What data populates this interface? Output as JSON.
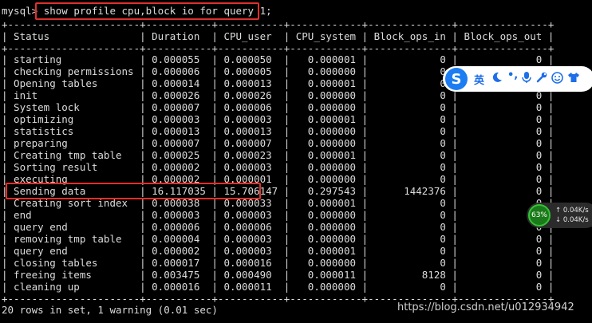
{
  "terminal": {
    "prompt": "mysql> ",
    "command": "show profile cpu,block io for query 1;",
    "separator": "+----------------------+-----------+-----------+------------+--------------+---------------+",
    "header": "| Status               | Duration  | CPU_user  | CPU_system | Block_ops_in | Block_ops_out |",
    "rows": [
      "| starting             | 0.000055  | 0.000050  |   0.000001 |            0 |             0 |",
      "| checking permissions | 0.000006  | 0.000005  |   0.000000 |            0 |             0 |",
      "| Opening tables       | 0.000014  | 0.000013  |   0.000001 |            0 |             0 |",
      "| init                 | 0.000026  | 0.000026  |   0.000000 |            0 |             0 |",
      "| System lock          | 0.000007  | 0.000006  |   0.000000 |            0 |             0 |",
      "| optimizing           | 0.000003  | 0.000003  |   0.000001 |            0 |             0 |",
      "| statistics           | 0.000013  | 0.000013  |   0.000000 |            0 |             0 |",
      "| preparing            | 0.000007  | 0.000007  |   0.000000 |            0 |             0 |",
      "| Creating tmp table   | 0.000025  | 0.000023  |   0.000001 |            0 |             0 |",
      "| Sorting result       | 0.000002  | 0.000003  |   0.000000 |            0 |             0 |",
      "| executing            | 0.000002  | 0.000001  |   0.000000 |            0 |             0 |",
      "| Sending data         | 16.117035 | 15.706147 |   0.297543 |      1442376 |             0 |",
      "| Creating sort index  | 0.000038  | 0.000033  |   0.000001 |            0 |             0 |",
      "| end                  | 0.000003  | 0.000003  |   0.000000 |            0 |             0 |",
      "| query end            | 0.000006  | 0.000006  |   0.000000 |            0 |             0 |",
      "| removing tmp table   | 0.000004  | 0.000003  |   0.000000 |            0 |             0 |",
      "| query end            | 0.000002  | 0.000003  |   0.000001 |            0 |             0 |",
      "| closing tables       | 0.000017  | 0.000016  |   0.000000 |            0 |             0 |",
      "| freeing items        | 0.003475  | 0.000490  |   0.000011 |         8128 |             0 |",
      "| cleaning up          | 0.000016  | 0.000011  |   0.000000 |            0 |             0 |"
    ],
    "footer": "20 rows in set, 1 warning (0.01 sec)"
  },
  "ime_toolbar": {
    "logo": "S",
    "lang": "英",
    "icons": [
      "moon-icon",
      "punctuation-icon",
      "microphone-icon",
      "wrench-icon",
      "smiley-icon",
      "shirt-icon"
    ]
  },
  "network_widget": {
    "percent": "63%",
    "upload": "0.04K/s",
    "download": "0.04K/s"
  },
  "watermark": "https://blog.csdn.net/u012934942",
  "colors": {
    "highlight": "#e0302a",
    "ime_blue": "#1c7cf2",
    "net_green": "#36c236"
  }
}
